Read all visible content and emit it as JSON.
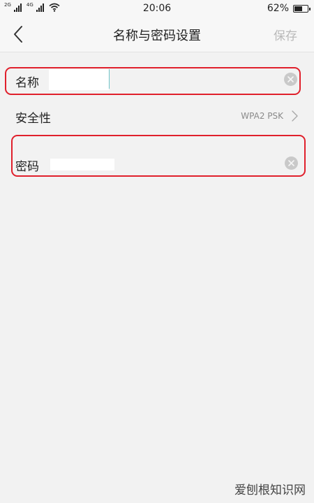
{
  "status_bar": {
    "network1": "2G",
    "network2": "4G",
    "time": "20:06",
    "battery_percent": "62%",
    "battery_level": 0.62
  },
  "header": {
    "back_icon": "chevron-left-icon",
    "title": "名称与密码设置",
    "save_label": "保存"
  },
  "form": {
    "name": {
      "label": "名称",
      "value": "",
      "clear_icon": "clear-circle-icon"
    },
    "security": {
      "label": "安全性",
      "value": "WPA2 PSK",
      "icon": "chevron-right-icon"
    },
    "password": {
      "label": "密码",
      "value": "",
      "clear_icon": "clear-circle-icon"
    }
  },
  "colors": {
    "highlight": "#e0202c",
    "background": "#f2f2f2",
    "save_disabled": "#b9b9b9"
  },
  "watermark": "爱刨根知识网"
}
